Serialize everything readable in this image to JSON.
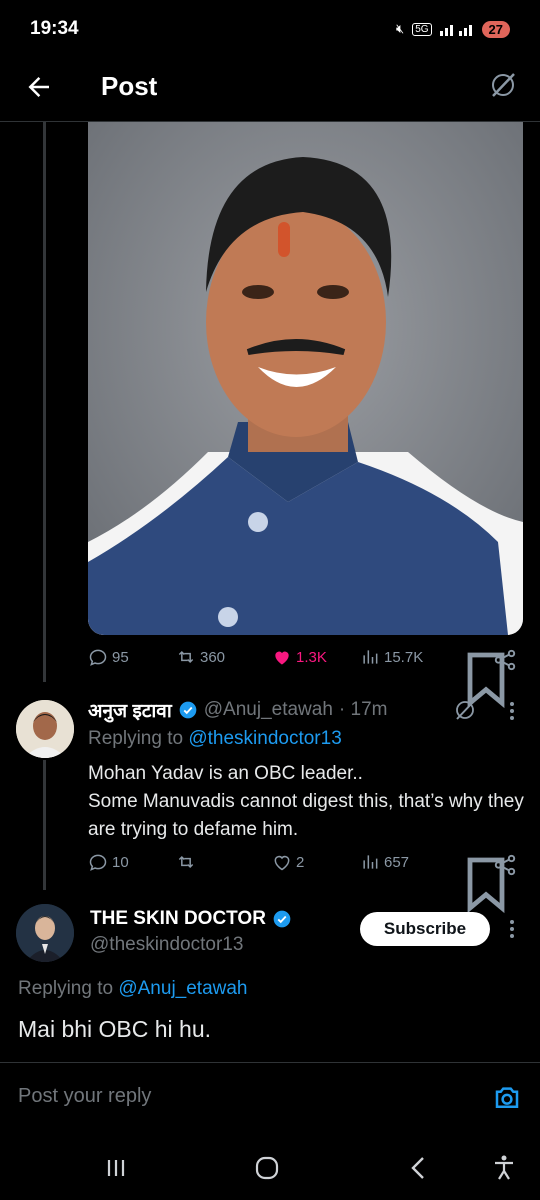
{
  "status_bar": {
    "time": "19:34",
    "network": "5G",
    "battery": "27"
  },
  "header": {
    "title": "Post"
  },
  "post": {
    "image_alt": "Portrait photo of a smiling man in a blue nehru jacket",
    "stats": {
      "replies": "95",
      "reposts": "360",
      "likes": "1.3K",
      "views": "15.7K"
    }
  },
  "reply1": {
    "name": "अनुज इटावा",
    "handle": "@Anuj_etawah",
    "time": "· 17m",
    "replying_prefix": "Replying to ",
    "replying_to": "@theskindoctor13",
    "text_lines": [
      "Mohan Yadav is an OBC leader..",
      "Some Manuvadis cannot digest this, that’s why they are trying to defame him."
    ],
    "stats": {
      "replies": "10",
      "reposts": "",
      "likes": "2",
      "views": "657"
    }
  },
  "reply2": {
    "name": "THE SKIN DOCTOR",
    "handle": "@theskindoctor13",
    "subscribe_label": "Subscribe",
    "replying_prefix": "Replying to ",
    "replying_to": "@Anuj_etawah",
    "text": "Mai bhi OBC hi hu."
  },
  "composer": {
    "placeholder": "Post your reply"
  },
  "colors": {
    "accent": "#1d9bf0",
    "like": "#f91880",
    "muted": "#71767b",
    "background": "#000000"
  }
}
